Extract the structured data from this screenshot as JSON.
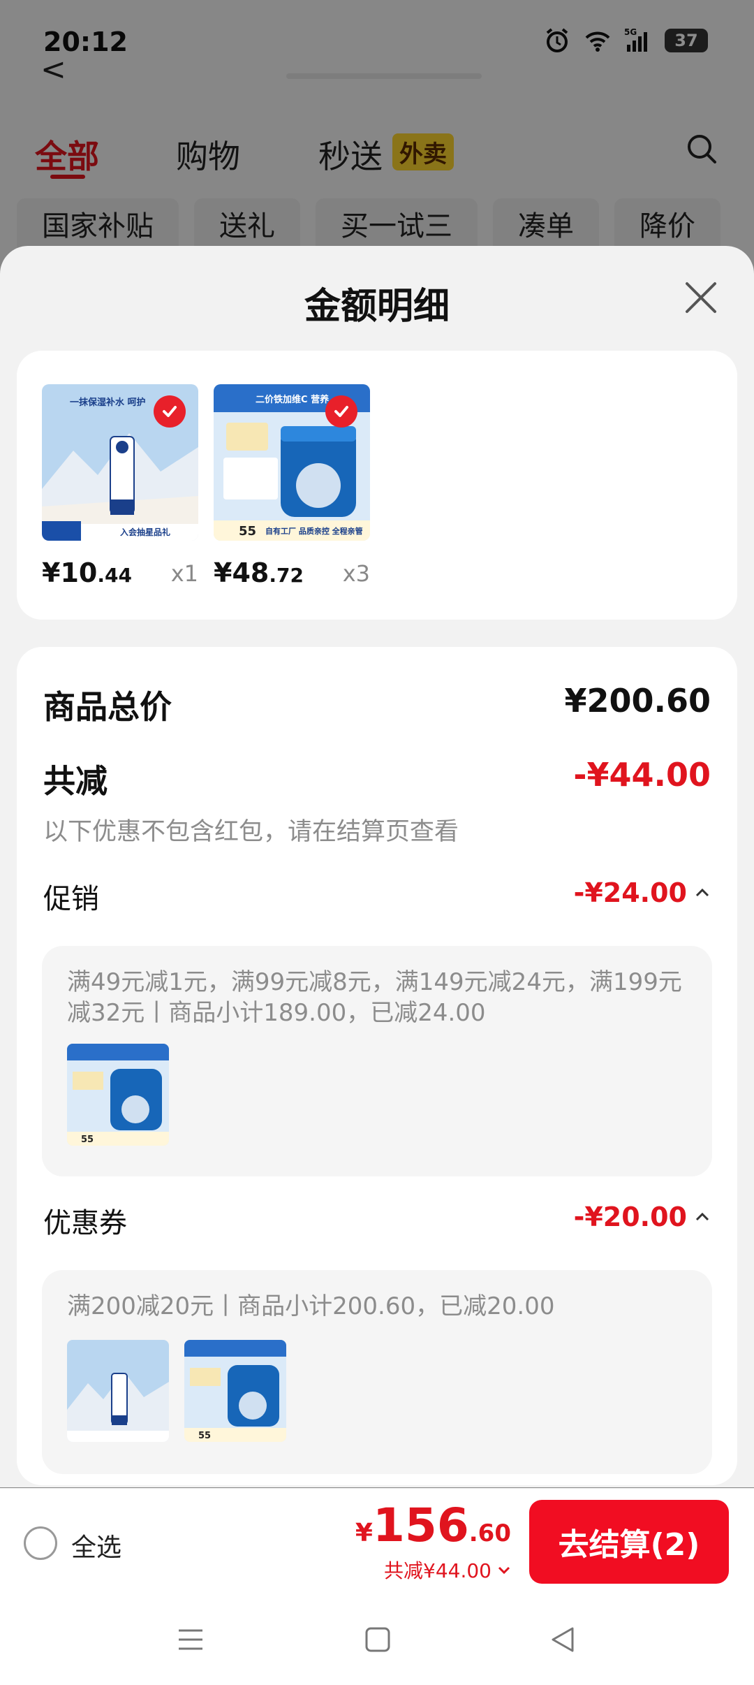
{
  "status_bar": {
    "time": "20:12",
    "battery": "37",
    "network": "5G"
  },
  "background": {
    "back_label": "<",
    "tabs": [
      {
        "label": "全部",
        "active": true
      },
      {
        "label": "购物",
        "active": false
      },
      {
        "label": "秒送",
        "active": false
      }
    ],
    "waimai_badge": "外卖",
    "chips": [
      "国家补贴",
      "送礼",
      "买一试三",
      "凑单",
      "降价"
    ]
  },
  "sheet": {
    "title": "金额明细",
    "products": [
      {
        "price_int": "¥10",
        "price_dec": ".44",
        "qty": "x1",
        "checked": true,
        "img_text": "一抹保湿补水 呵护",
        "img_badge": "入会抽星品礼"
      },
      {
        "price_int": "¥48",
        "price_dec": ".72",
        "qty": "x3",
        "checked": true,
        "img_text": "二价铁加维C 营养",
        "img_badge": "自有工厂 品质亲控 全程亲管"
      }
    ],
    "summary": {
      "total_label": "商品总价",
      "total_value": "¥200.60",
      "reduce_label": "共减",
      "reduce_value": "-¥44.00",
      "reduce_hint": "以下优惠不包含红包，请在结算页查看"
    },
    "promotion": {
      "label": "促销",
      "value": "-¥24.00",
      "detail": "满49元减1元，满99元减8元，满149元减24元，满199元减32元丨商品小计189.00，已减24.00"
    },
    "coupon": {
      "label": "优惠券",
      "value": "-¥20.00",
      "detail": "满200减20元丨商品小计200.60，已减20.00"
    }
  },
  "bottom_bar": {
    "select_all": "全选",
    "price_currency": "¥",
    "price_int": "156",
    "price_dec": ".60",
    "reduce_text": "共减¥44.00",
    "checkout_label": "去结算(2)"
  },
  "colors": {
    "accent": "#e0141e",
    "button": "#f10d22"
  }
}
